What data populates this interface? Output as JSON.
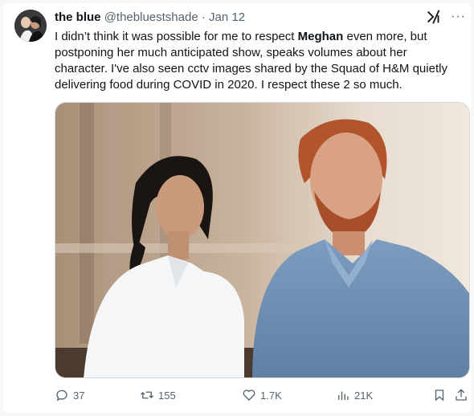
{
  "author": {
    "display_name": "the blue",
    "handle": "@thebluestshade",
    "separator": "·",
    "date": "Jan 12"
  },
  "tweet": {
    "text_before": "I didn’t think it was possible for me to respect ",
    "text_bold": "Meghan",
    "text_after": " even more, but postponing her much anticipated show, speaks volumes about her character. I've also seen cctv images shared by the Squad of H&M quietly delivering food during COVID in 2020. I respect these 2 so much."
  },
  "top_icons": {
    "grok": "grok-icon",
    "more": "···"
  },
  "media": {
    "description_icon": "photo-two-people"
  },
  "actions": {
    "replies": "37",
    "reposts": "155",
    "likes": "1.7K",
    "views": "21K"
  },
  "colors": {
    "text": "#0f1419",
    "muted": "#536471",
    "border": "#cfd9de"
  }
}
